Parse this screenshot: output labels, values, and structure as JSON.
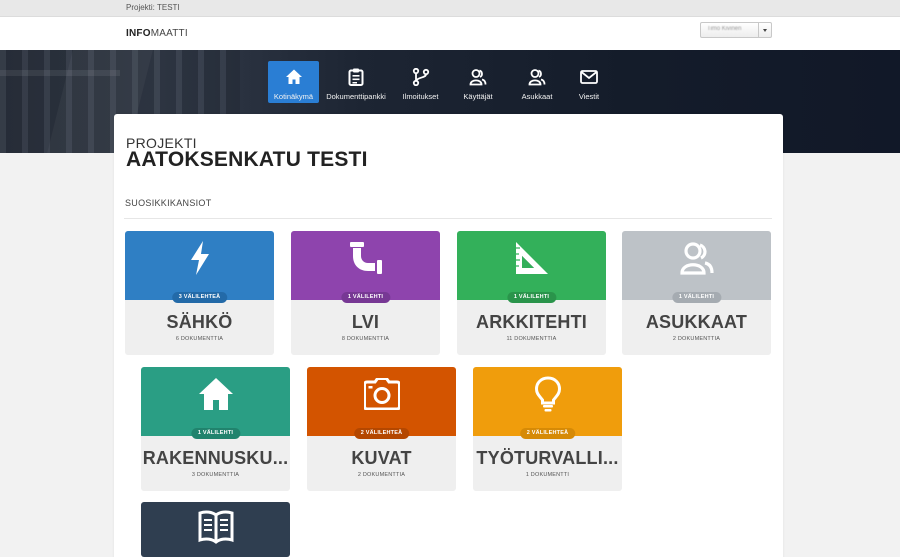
{
  "topbar": {
    "project_text": "Projekti: TESTI"
  },
  "header": {
    "logo_bold": "INFO",
    "logo_light": "MAATTI",
    "user_name": "Timo Kivinen"
  },
  "nav": {
    "items": [
      {
        "label": "Kotinäkymä",
        "icon": "home-icon",
        "active": true
      },
      {
        "label": "Dokumenttipankki",
        "icon": "clipboard-icon",
        "active": false
      },
      {
        "label": "Ilmoitukset",
        "icon": "branch-icon",
        "active": false
      },
      {
        "label": "Käyttäjät",
        "icon": "users-icon",
        "active": false
      },
      {
        "label": "Asukkaat",
        "icon": "residents-icon",
        "active": false
      },
      {
        "label": "Viestit",
        "icon": "envelope-icon",
        "active": false
      }
    ]
  },
  "project": {
    "label": "PROJEKTI",
    "title": "AATOKSENKATU TESTI"
  },
  "favorites": {
    "section_title": "SUOSIKKIKANSIOT",
    "cards": [
      {
        "title": "SÄHKÖ",
        "badge": "3 VÄLILEHTEÄ",
        "docs": "6 DOKUMENTTIA",
        "color": "#2f7fc4",
        "badge_color": "#236aa8",
        "icon": "lightning-icon"
      },
      {
        "title": "LVI",
        "badge": "1 VÄLILEHTI",
        "docs": "8 DOKUMENTTIA",
        "color": "#8e44ad",
        "badge_color": "#773894",
        "icon": "pipe-icon"
      },
      {
        "title": "ARKKITEHTI",
        "badge": "1 VÄLILEHTI",
        "docs": "11 DOKUMENTTIA",
        "color": "#33b05a",
        "badge_color": "#2a944b",
        "icon": "set-square-icon"
      },
      {
        "title": "ASUKKAAT",
        "badge": "1 VÄLILEHTI",
        "docs": "2 DOKUMENTTIA",
        "color": "#bdc2c7",
        "badge_color": "#a5abb1",
        "icon": "residents-icon"
      },
      {
        "title": "RAKENNUSKU...",
        "badge": "1 VÄLILEHTI",
        "docs": "3 DOKUMENTTIA",
        "color": "#2a9e84",
        "badge_color": "#21836d",
        "icon": "house-icon"
      },
      {
        "title": "KUVAT",
        "badge": "2 VÄLILEHTEÄ",
        "docs": "2 DOKUMENTTIA",
        "color": "#d35400",
        "badge_color": "#b44700",
        "icon": "camera-icon"
      },
      {
        "title": "TYÖTURVALLI...",
        "badge": "2 VÄLILEHTEÄ",
        "docs": "1 DOKUMENTTI",
        "color": "#f09d0c",
        "badge_color": "#d68a06",
        "icon": "lightbulb-icon"
      },
      {
        "title": "",
        "badge": "",
        "docs": "",
        "color": "#2f3e50",
        "badge_color": "#263444",
        "icon": "book-icon"
      }
    ]
  }
}
